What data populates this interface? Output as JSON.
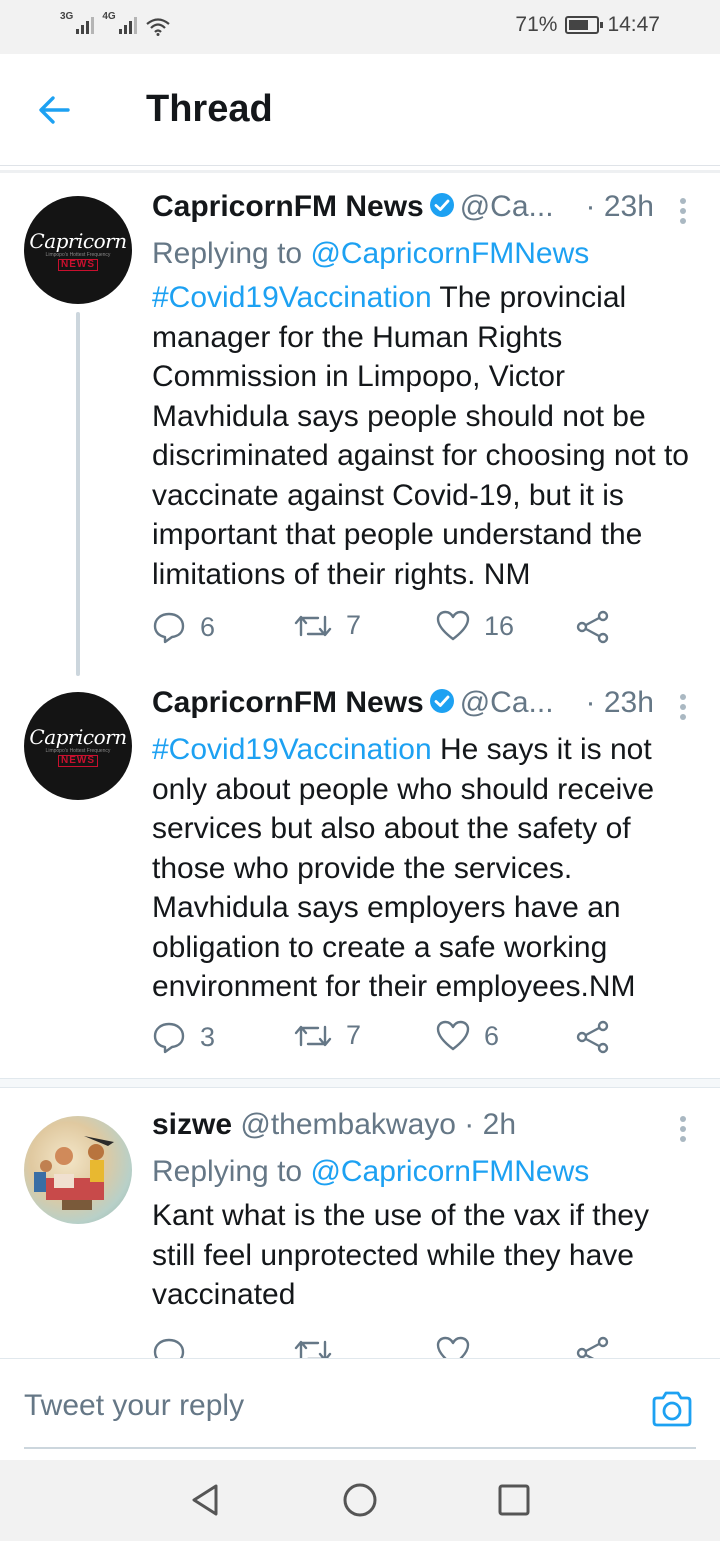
{
  "status_bar": {
    "network1": "3G",
    "network2": "4G",
    "battery": "71%",
    "time": "14:47"
  },
  "header": {
    "title": "Thread"
  },
  "tweets": [
    {
      "name": "CapricornFM News",
      "handle": "@Ca...",
      "dot": "·",
      "time": "23h",
      "replying_prefix": "Replying to ",
      "replying_to": "@CapricornFMNews",
      "hashtag": "#Covid19Vaccination",
      "text": " The provincial manager for the Human Rights Commission in Limpopo, Victor Mavhidula says people should not be discriminated against for choosing not to vaccinate against Covid-19, but it is important that people understand the limitations of their rights. NM",
      "replies": "6",
      "retweets": "7",
      "likes": "16"
    },
    {
      "name": "CapricornFM News",
      "handle": "@Ca...",
      "dot": "·",
      "time": "23h",
      "hashtag": "#Covid19Vaccination",
      "text": " He says it is not only about people who should receive services but also about the safety of those who provide the services. Mavhidula says employers have an obligation to create a safe working environment for their employees.NM",
      "replies": "3",
      "retweets": "7",
      "likes": "6"
    },
    {
      "name": "sizwe",
      "handle": "@thembakwayo",
      "dot": "·",
      "time": "2h",
      "replying_prefix": "Replying to ",
      "replying_to": "@CapricornFMNews",
      "text": "Kant what is the use of the vax if they still feel unprotected while they have vaccinated"
    }
  ],
  "avatar_logo": {
    "wordmark": "Capricorn",
    "tag": "Limpopo's Hottest Frequency",
    "news": "NEWS"
  },
  "reply_bar": {
    "placeholder": "Tweet your reply"
  },
  "colors": {
    "accent": "#1da1f2",
    "text": "#14171a",
    "muted": "#657786"
  }
}
